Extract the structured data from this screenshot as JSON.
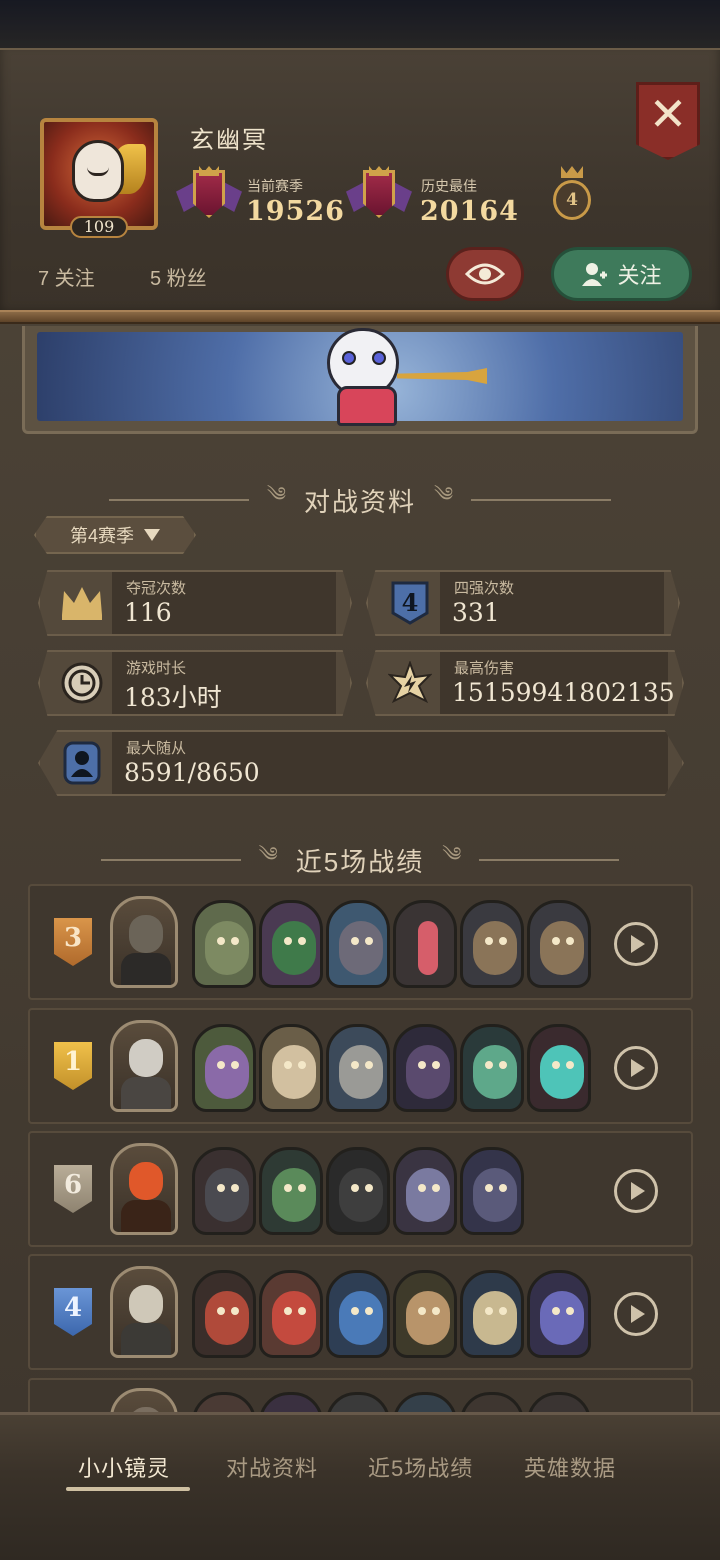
{
  "header": {
    "player_name": "玄幽冥",
    "level": "109",
    "current_season_label": "当前赛季",
    "current_season_score": "19526",
    "history_best_label": "历史最佳",
    "history_best_score": "20164",
    "rank_medal": "4",
    "following": "7 关注",
    "followers": "5 粉丝",
    "follow_button": "关注",
    "close": "✕"
  },
  "battle_section": {
    "title": "对战资料",
    "season_selector": "第4赛季",
    "stats": [
      {
        "label": "夺冠次数",
        "value": "116",
        "icon": "crown-icon"
      },
      {
        "label": "四强次数",
        "value": "331",
        "icon": "top-four-icon"
      },
      {
        "label": "游戏时长",
        "value": "183小时",
        "icon": "clock-icon"
      },
      {
        "label": "最高伤害",
        "value": "15159941802135",
        "icon": "damage-star-icon"
      },
      {
        "label": "最大随从",
        "value": "8591/8650",
        "icon": "minion-icon"
      }
    ]
  },
  "recent_section": {
    "title": "近5场战绩",
    "matches": [
      {
        "place": "3",
        "minion_count": 6
      },
      {
        "place": "1",
        "minion_count": 6
      },
      {
        "place": "6",
        "minion_count": 5
      },
      {
        "place": "4",
        "minion_count": 6
      }
    ]
  },
  "bottom_nav": {
    "items": [
      "小小镜灵",
      "对战资料",
      "近5场战绩",
      "英雄数据"
    ],
    "active": "小小镜灵"
  },
  "colors": {
    "panel_bg": "#3f372e",
    "accent_gold": "#f3d9a0",
    "follow_green": "#3e7a5b",
    "eye_red": "#8e3a33",
    "close_red": "#8a2e28"
  }
}
